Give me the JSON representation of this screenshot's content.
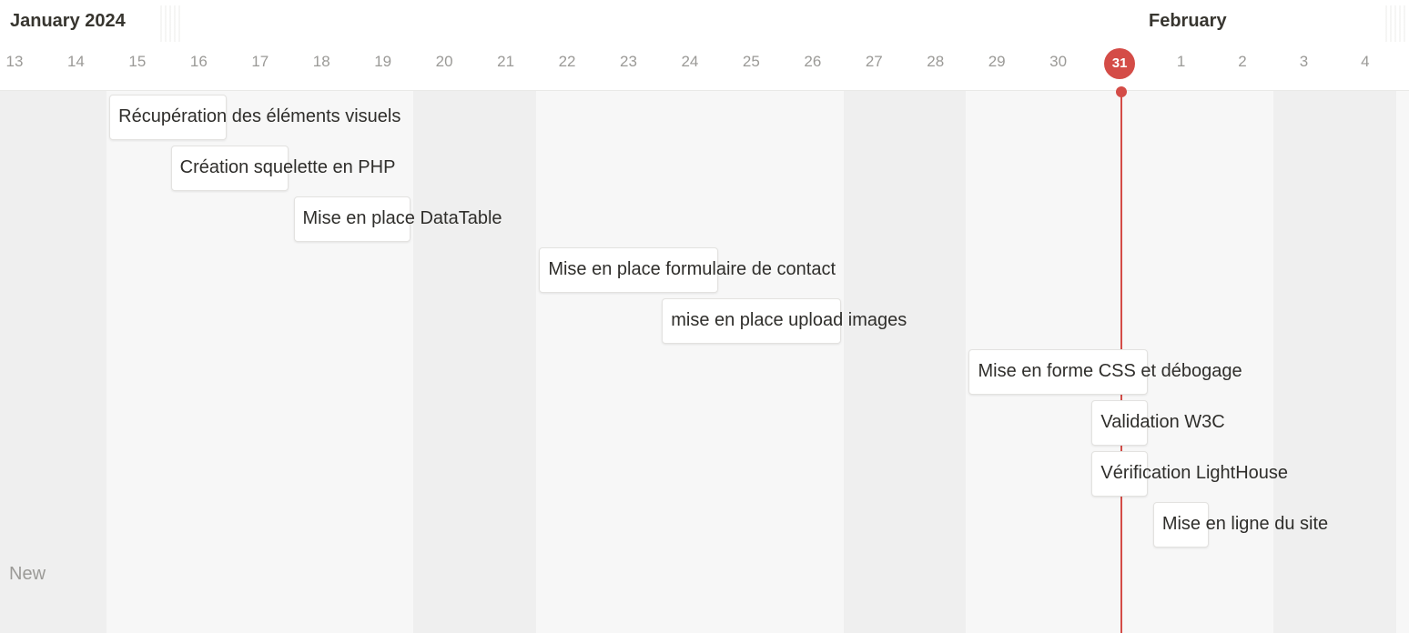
{
  "months": [
    {
      "label": "January 2024"
    },
    {
      "label": "February"
    }
  ],
  "days": [
    "13",
    "14",
    "15",
    "16",
    "17",
    "18",
    "19",
    "20",
    "21",
    "22",
    "23",
    "24",
    "25",
    "26",
    "27",
    "28",
    "29",
    "30",
    "31",
    "1",
    "2",
    "3",
    "4"
  ],
  "today": "31",
  "weekend_shading": [
    {
      "from_day": "13",
      "to_day": "14"
    },
    {
      "from_day": "20",
      "to_day": "21"
    },
    {
      "from_day": "27",
      "to_day": "28"
    },
    {
      "from_day": "3",
      "to_day": "4"
    }
  ],
  "tasks": [
    {
      "title": "Récupération des éléments visuels",
      "start": "15",
      "end": "16"
    },
    {
      "title": "Création squelette en PHP",
      "start": "16",
      "end": "17"
    },
    {
      "title": "Mise en place DataTable",
      "start": "18",
      "end": "19"
    },
    {
      "title": "Mise en place formulaire de contact",
      "start": "22",
      "end": "24"
    },
    {
      "title": "mise en place upload images",
      "start": "24",
      "end": "26"
    },
    {
      "title": "Mise en forme CSS et débogage",
      "start": "29",
      "end": "31"
    },
    {
      "title": "Validation W3C",
      "start": "31",
      "end": "31"
    },
    {
      "title": "Vérification LightHouse",
      "start": "31",
      "end": "31"
    },
    {
      "title": "Mise en ligne du site",
      "start": "1",
      "end": "1"
    }
  ],
  "new_button": {
    "label": "New"
  },
  "colors": {
    "today_accent": "#d44c47",
    "weekend_shade": "#efefef",
    "body_bg": "#f7f7f7",
    "card_bg": "#ffffff"
  }
}
